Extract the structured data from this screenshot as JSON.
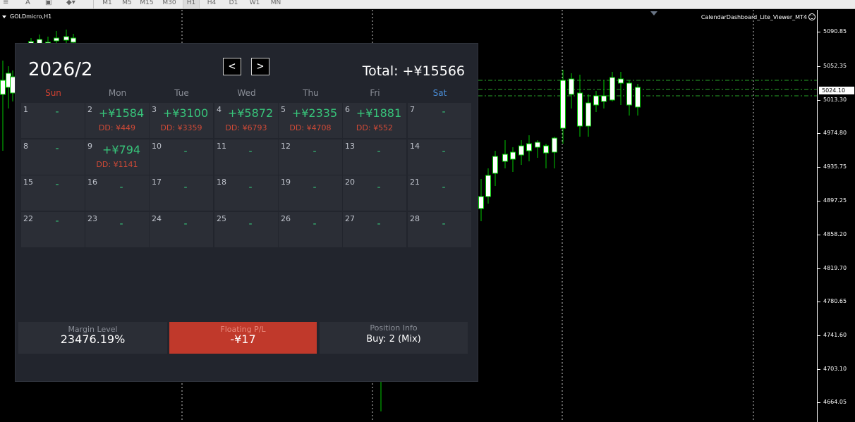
{
  "toolbar": {
    "items": [
      "A"
    ],
    "timeframes": [
      "M1",
      "M5",
      "M15",
      "M30",
      "H1",
      "H4",
      "D1",
      "W1",
      "MN"
    ],
    "active_timeframe": "H1"
  },
  "chart": {
    "symbol": "GOLDmicro,H1",
    "ea_name": "CalendarDashboard_Lite_Viewer_MT4",
    "current_price": "5024.10",
    "price_levels": [
      "5090.85",
      "5052.35",
      "5013.30",
      "4974.80",
      "4935.75",
      "4897.25",
      "4858.20",
      "4819.70",
      "4780.65",
      "4741.60",
      "4703.10",
      "4664.05"
    ]
  },
  "calendar": {
    "month_title": "2026/2",
    "prev_label": "<",
    "next_label": ">",
    "total": "Total: +¥15566",
    "weekdays": [
      "Sun",
      "Mon",
      "Tue",
      "Wed",
      "Thu",
      "Fri",
      "Sat"
    ],
    "weeks": [
      [
        {
          "day": "1",
          "pl": "-",
          "dd": ""
        },
        {
          "day": "2",
          "pl": "+¥1584",
          "dd": "DD: ¥449"
        },
        {
          "day": "3",
          "pl": "+¥3100",
          "dd": "DD: ¥3359"
        },
        {
          "day": "4",
          "pl": "+¥5872",
          "dd": "DD: ¥6793"
        },
        {
          "day": "5",
          "pl": "+¥2335",
          "dd": "DD: ¥4708"
        },
        {
          "day": "6",
          "pl": "+¥1881",
          "dd": "DD: ¥552"
        },
        {
          "day": "7",
          "pl": "-",
          "dd": ""
        }
      ],
      [
        {
          "day": "8",
          "pl": "-",
          "dd": ""
        },
        {
          "day": "9",
          "pl": "+¥794",
          "dd": "DD: ¥1141"
        },
        {
          "day": "10",
          "pl": "-",
          "dd": ""
        },
        {
          "day": "11",
          "pl": "-",
          "dd": ""
        },
        {
          "day": "12",
          "pl": "-",
          "dd": ""
        },
        {
          "day": "13",
          "pl": "-",
          "dd": ""
        },
        {
          "day": "14",
          "pl": "-",
          "dd": ""
        }
      ],
      [
        {
          "day": "15",
          "pl": "-",
          "dd": ""
        },
        {
          "day": "16",
          "pl": "-",
          "dd": ""
        },
        {
          "day": "17",
          "pl": "-",
          "dd": ""
        },
        {
          "day": "18",
          "pl": "-",
          "dd": ""
        },
        {
          "day": "19",
          "pl": "-",
          "dd": ""
        },
        {
          "day": "20",
          "pl": "-",
          "dd": ""
        },
        {
          "day": "21",
          "pl": "-",
          "dd": ""
        }
      ],
      [
        {
          "day": "22",
          "pl": "-",
          "dd": ""
        },
        {
          "day": "23",
          "pl": "-",
          "dd": ""
        },
        {
          "day": "24",
          "pl": "-",
          "dd": ""
        },
        {
          "day": "25",
          "pl": "-",
          "dd": ""
        },
        {
          "day": "26",
          "pl": "-",
          "dd": ""
        },
        {
          "day": "27",
          "pl": "-",
          "dd": ""
        },
        {
          "day": "28",
          "pl": "-",
          "dd": ""
        }
      ]
    ]
  },
  "stats": {
    "margin_label": "Margin Level",
    "margin_value": "23476.19%",
    "floating_label": "Floating P/L",
    "floating_value": "-¥17",
    "position_label": "Position Info",
    "position_value": "Buy: 2 (Mix)"
  },
  "colors": {
    "panel_bg": "#22252d",
    "cell_bg": "#2b2e36",
    "profit": "#37c47a",
    "loss": "#d14a36",
    "floating_bg": "#c0392b",
    "sunday": "#d04030",
    "saturday": "#4a8ed8",
    "candle_up": "#00c800",
    "candle_down": "#ffffff"
  }
}
